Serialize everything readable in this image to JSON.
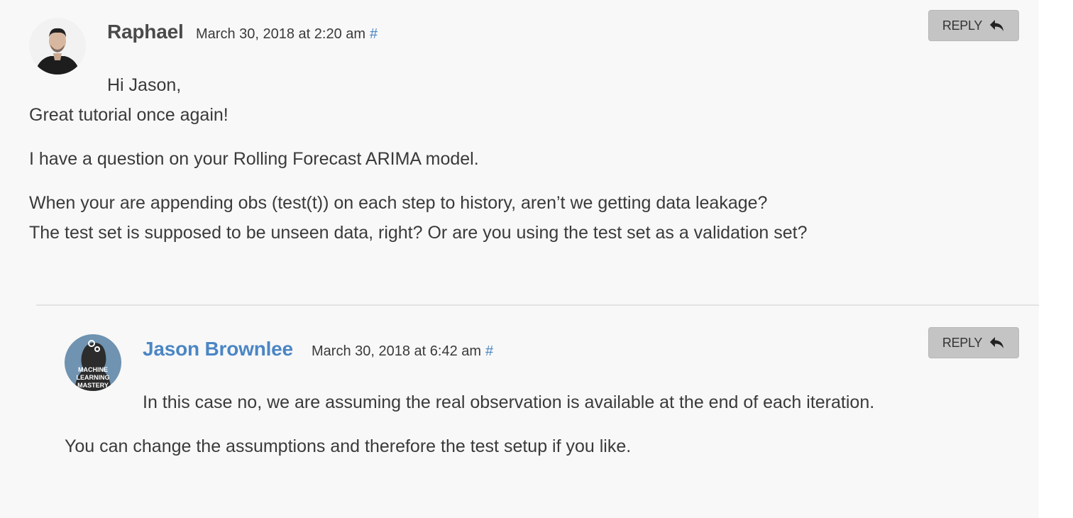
{
  "comments": [
    {
      "author": "Raphael",
      "date": "March 30, 2018 at 2:20 am",
      "permalink": "#",
      "reply_label": "REPLY",
      "lines": [
        "Hi Jason,",
        "Great tutorial once again!",
        "I have a question on your Rolling Forecast ARIMA model.",
        "When your are appending obs (test(t)) on each step to history, aren’t we getting data leakage?",
        "The test set is supposed to be unseen data, right? Or are you using the test set as a validation set?"
      ]
    },
    {
      "author": "Jason Brownlee",
      "date": "March 30, 2018 at 6:42 am",
      "permalink": "#",
      "reply_label": "REPLY",
      "avatar_text": [
        "MACHINE",
        "LEARNING",
        "MASTERY"
      ],
      "lines": [
        "In this case no, we are assuming the real observation is available at the end of each iteration.",
        "You can change the assumptions and therefore the test setup if you like."
      ]
    }
  ],
  "colors": {
    "background": "#f8f8f8",
    "link": "#4b86c4",
    "text": "#3a3a3a",
    "reply_button": "#c4c4c4"
  },
  "icons": [
    "reply-arrow-icon",
    "avatar-photo",
    "machine-learning-mastery-logo"
  ]
}
